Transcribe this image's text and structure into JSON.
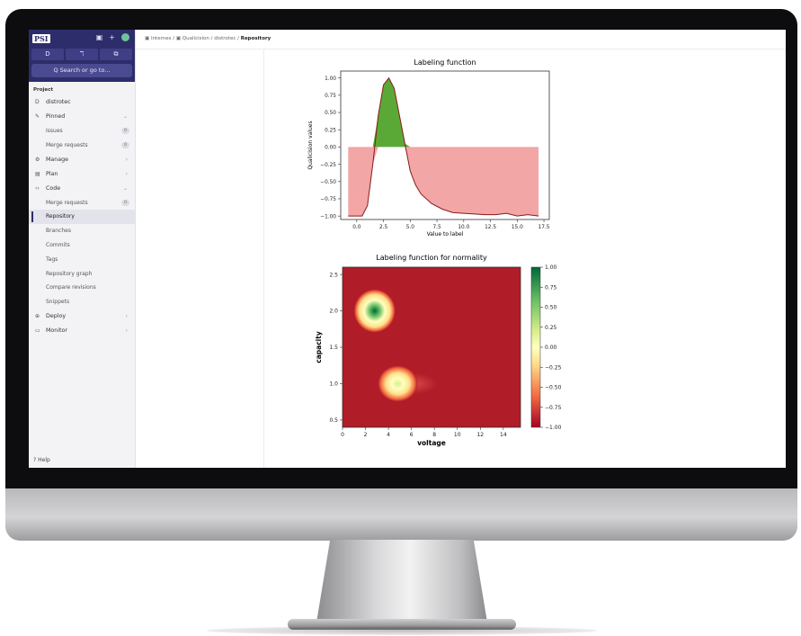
{
  "sidebar": {
    "logo": "PSI",
    "quick_buttons": [
      "D",
      "ℸ",
      "⧉"
    ],
    "search": "Q Search or go to...",
    "project_label": "Project",
    "project_name": "distrotec",
    "nav": [
      {
        "label": "Pinned",
        "icon": "pin-icon"
      },
      {
        "label": "Issues",
        "badge": "0"
      },
      {
        "label": "Merge requests",
        "badge": "0"
      },
      {
        "label": "Manage",
        "icon": "manage-icon"
      },
      {
        "label": "Plan",
        "icon": "plan-icon"
      },
      {
        "label": "Code",
        "icon": "code-icon"
      },
      {
        "label": "Merge requests",
        "badge": "0"
      },
      {
        "label": "Repository"
      },
      {
        "label": "Branches"
      },
      {
        "label": "Commits"
      },
      {
        "label": "Tags"
      },
      {
        "label": "Repository graph"
      },
      {
        "label": "Compare revisions"
      },
      {
        "label": "Snippets"
      },
      {
        "label": "Deploy",
        "icon": "deploy-icon"
      },
      {
        "label": "Monitor",
        "icon": "monitor-icon"
      }
    ],
    "help": "Help"
  },
  "breadcrumb": [
    "Internes",
    "Qualicision",
    "distrotec",
    "Repository"
  ],
  "chart_data": [
    {
      "type": "area",
      "title": "Labeling function",
      "xlabel": "Value to label",
      "ylabel": "Qualicision values",
      "xticks": [
        "0.0",
        "2.5",
        "5.0",
        "7.5",
        "10.0",
        "12.5",
        "15.0",
        "17.5"
      ],
      "yticks": [
        "1.00",
        "0.75",
        "0.50",
        "0.25",
        "0.00",
        "−0.25",
        "−0.50",
        "−0.75",
        "−1.00"
      ],
      "xlim": [
        -1.5,
        18
      ],
      "ylim": [
        -1.05,
        1.1
      ],
      "x": [
        -0.8,
        0.5,
        1.0,
        1.5,
        2.0,
        2.5,
        3.0,
        3.5,
        4.0,
        4.5,
        5.0,
        5.5,
        6.0,
        7.0,
        8.0,
        9.0,
        10.0,
        11.0,
        12.0,
        13.0,
        14.0,
        15.0,
        16.0,
        17.0
      ],
      "y": [
        -1.0,
        -1.0,
        -0.85,
        -0.25,
        0.45,
        0.9,
        1.0,
        0.85,
        0.45,
        0.05,
        -0.35,
        -0.55,
        -0.68,
        -0.82,
        -0.9,
        -0.95,
        -0.96,
        -0.97,
        -0.98,
        -0.98,
        -0.96,
        -1.0,
        -0.98,
        -1.0
      ],
      "positive_color": "#5aa936",
      "negative_color": "#f2a6a6"
    },
    {
      "type": "heatmap",
      "title": "Labeling function for normality",
      "xlabel": "voltage",
      "ylabel": "capacity",
      "xticks": [
        "0",
        "2",
        "4",
        "6",
        "8",
        "10",
        "12",
        "14"
      ],
      "yticks": [
        "2.5",
        "2.0",
        "1.5",
        "1.0",
        "0.5"
      ],
      "xlim": [
        0,
        15.5
      ],
      "ylim": [
        0.4,
        2.6
      ],
      "colorbar_ticks": [
        "1.00",
        "0.75",
        "0.50",
        "0.25",
        "0.00",
        "−0.25",
        "−0.50",
        "−0.75",
        "−1.00"
      ],
      "colorbar_range": [
        -1,
        1
      ],
      "blobs": [
        {
          "voltage": 2.8,
          "capacity": 2.0,
          "peak": 1.0
        },
        {
          "voltage": 4.5,
          "capacity": 1.0,
          "peak": 0.3
        }
      ],
      "background_color": "#b01c27",
      "colors": [
        "#a50026",
        "#f46d43",
        "#fee08b",
        "#ffffbf",
        "#d9ef8b",
        "#66bd63",
        "#006837"
      ]
    }
  ]
}
